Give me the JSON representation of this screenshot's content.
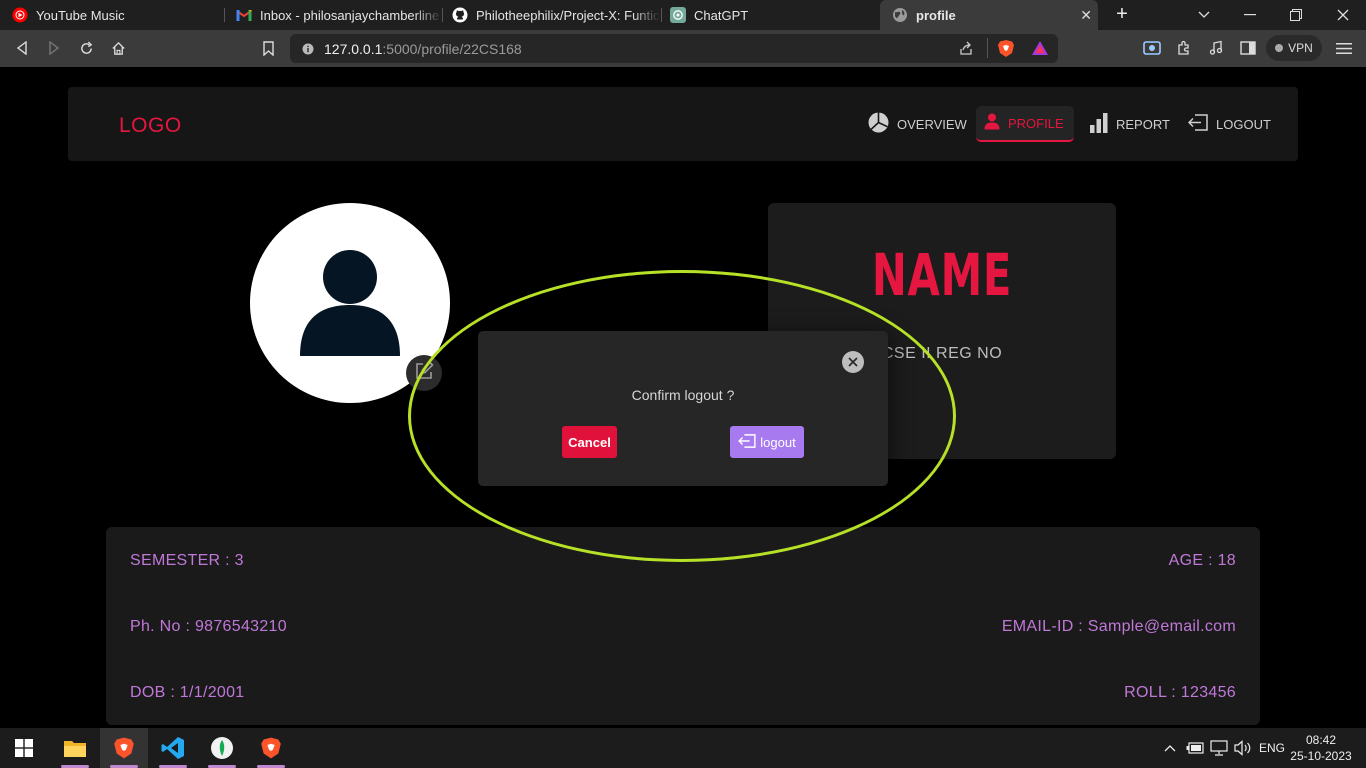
{
  "browser": {
    "tabs": [
      {
        "title": "YouTube Music",
        "icon": "youtube-music-icon"
      },
      {
        "title": "Inbox - philosanjaychamberline.26",
        "icon": "gmail-icon"
      },
      {
        "title": "Philotheephilix/Project-X: Funtional",
        "icon": "github-icon"
      },
      {
        "title": "ChatGPT",
        "icon": "chatgpt-icon"
      },
      {
        "title": "profile",
        "icon": "globe-icon",
        "active": true
      }
    ],
    "url_host": "127.0.0.1",
    "url_path": ":5000/profile/22CS168",
    "vpn_label": "VPN"
  },
  "app": {
    "logo": "LOGO",
    "nav": [
      {
        "label": "OVERVIEW",
        "icon": "pie-chart-icon"
      },
      {
        "label": "PROFILE",
        "icon": "user-icon",
        "active": true
      },
      {
        "label": "REPORT",
        "icon": "bar-chart-icon"
      },
      {
        "label": "LOGOUT",
        "icon": "logout-icon"
      }
    ],
    "profile": {
      "name": "NAME",
      "dept_line": "CSE  II  REG NO",
      "semester": "SEMESTER : 3",
      "age": "AGE : 18",
      "phone": "Ph. No : 9876543210",
      "email": "EMAIL-ID : Sample@email.com",
      "dob": "DOB : 1/1/2001",
      "roll": "ROLL : 123456"
    },
    "modal": {
      "message": "Confirm logout ?",
      "cancel_label": "Cancel",
      "logout_label": "logout"
    }
  },
  "taskbar": {
    "lang": "ENG",
    "time": "08:42",
    "date": "25-10-2023"
  },
  "colors": {
    "accent_red": "#e5163f",
    "detail_purple": "#c078d8",
    "logout_button": "#a77af0",
    "highlight_ring": "#b6e127"
  }
}
